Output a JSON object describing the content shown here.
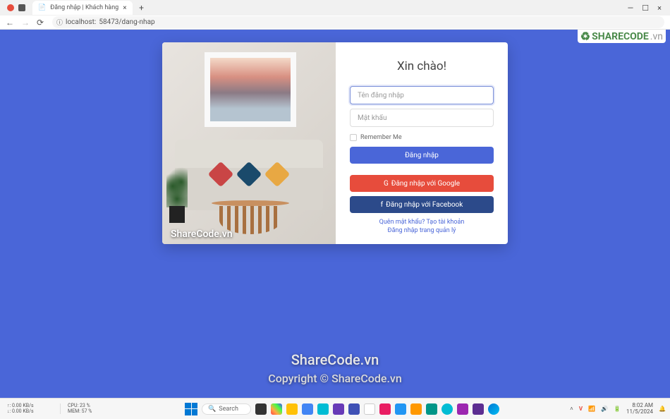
{
  "browser": {
    "tab_title": "Đăng nhập | Khách hàng",
    "url_prefix": "localhost:",
    "url_port_path": "58473/dang-nhap"
  },
  "watermark_logo": "SHARECODE",
  "watermark_logo_suffix": ".vn",
  "login": {
    "title": "Xin chào!",
    "username_placeholder": "Tên đăng nhập",
    "password_placeholder": "Mật khẩu",
    "remember_label": "Remember Me",
    "submit_label": "Đăng nhập",
    "google_label": "Đăng nhập với Google",
    "facebook_label": "Đăng nhập với Facebook",
    "forgot_label": "Quên mật khẩu?",
    "create_label": "Tạo tài khoản",
    "admin_login_label": "Đăng nhập trang quản lý",
    "image_watermark": "ShareCode.vn"
  },
  "page_watermarks": {
    "wm1": "ShareCode.vn",
    "wm2": "Copyright © ShareCode.vn"
  },
  "taskbar": {
    "net_down": "0.00 KB/s",
    "net_up": "0.00 KB/s",
    "cpu_label": "CPU:",
    "cpu_value": "23 %",
    "mem_label": "MEM:",
    "mem_value": "57 %",
    "search_placeholder": "Search",
    "time": "8:02 AM",
    "date": "11/5/2024"
  }
}
